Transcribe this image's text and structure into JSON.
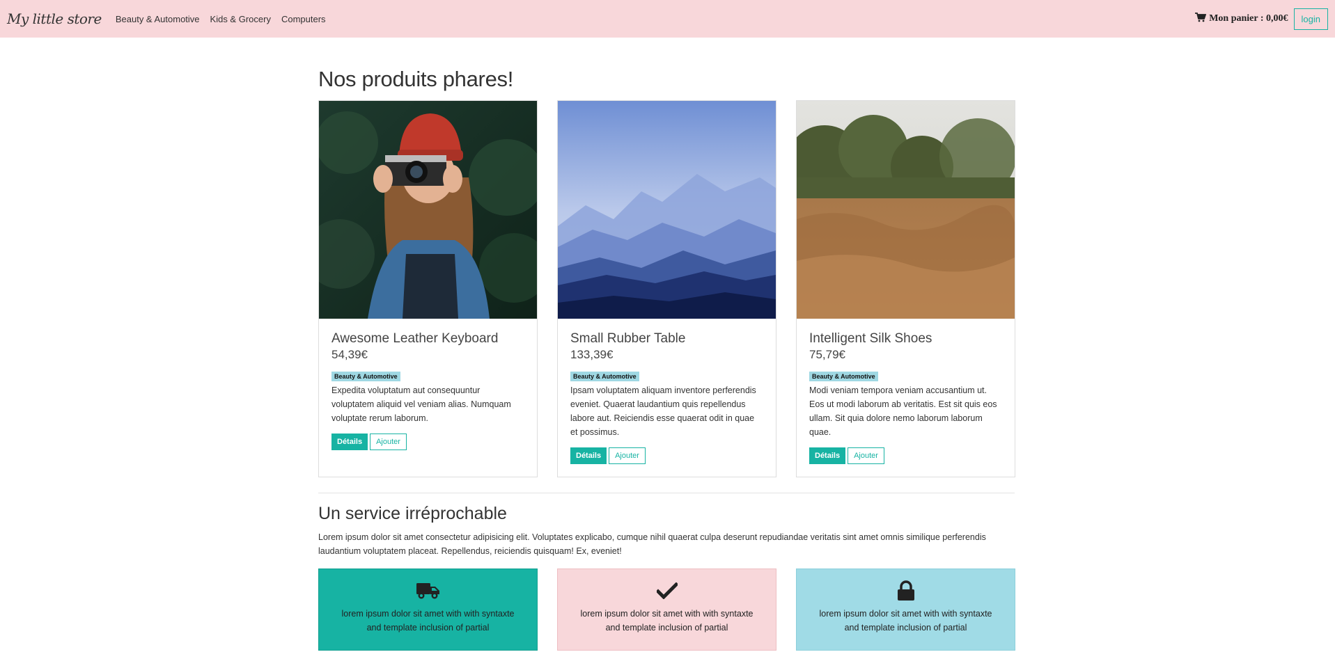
{
  "navbar": {
    "brand": "My little store",
    "links": [
      "Beauty & Automotive",
      "Kids & Grocery",
      "Computers"
    ],
    "cart_label": "Mon panier : 0,00€",
    "login_label": "login"
  },
  "main": {
    "title": "Nos produits phares!",
    "products": [
      {
        "name": "Awesome Leather Keyboard",
        "price": "54,39€",
        "category": "Beauty & Automotive",
        "description": "Expedita voluptatum aut consequuntur voluptatem aliquid vel veniam alias. Numquam voluptate rerum laborum.",
        "details_label": "Détails",
        "add_label": "Ajouter",
        "image": "photographer-with-camera"
      },
      {
        "name": "Small Rubber Table",
        "price": "133,39€",
        "category": "Beauty & Automotive",
        "description": "Ipsam voluptatem aliquam inventore perferendis eveniet. Quaerat laudantium quis repellendus labore aut. Reiciendis esse quaerat odit in quae et possimus.",
        "details_label": "Détails",
        "add_label": "Ajouter",
        "image": "misty-blue-mountains"
      },
      {
        "name": "Intelligent Silk Shoes",
        "price": "75,79€",
        "category": "Beauty & Automotive",
        "description": "Modi veniam tempora veniam accusantium ut. Eos ut modi laborum ab veritatis. Est sit quis eos ullam. Sit quia dolore nemo laborum laborum quae.",
        "details_label": "Détails",
        "add_label": "Ajouter",
        "image": "dry-grass-field"
      }
    ],
    "service": {
      "title": "Un service irréprochable",
      "text": "Lorem ipsum dolor sit amet consectetur adipisicing elit. Voluptates explicabo, cumque nihil quaerat culpa deserunt repudiandae veritatis sint amet omnis similique perferendis laudantium voluptatem placeat. Repellendus, reiciendis quisquam! Ex, eveniet!",
      "features": [
        {
          "icon": "truck-icon",
          "text": "lorem ipsum dolor sit amet with with syntaxte and template inclusion of partial",
          "color": "#17b3a3"
        },
        {
          "icon": "check-icon",
          "text": "lorem ipsum dolor sit amet with with syntaxte and template inclusion of partial",
          "color": "#f8d7da"
        },
        {
          "icon": "lock-icon",
          "text": "lorem ipsum dolor sit amet with with syntaxte and template inclusion of partial",
          "color": "#a0dbe6"
        }
      ]
    }
  },
  "colors": {
    "navbar_bg": "#f8d7da",
    "accent": "#17b3a3",
    "badge": "#9fd8e3"
  }
}
